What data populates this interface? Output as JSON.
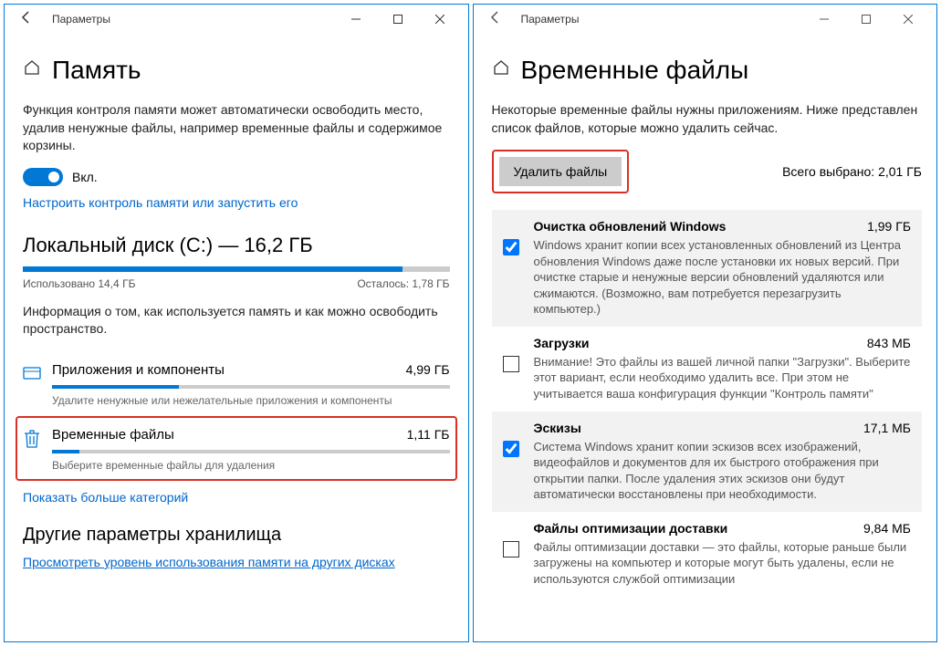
{
  "left": {
    "window_title": "Параметры",
    "page_title": "Память",
    "intro": "Функция контроля памяти может автоматически освободить место, удалив ненужные файлы, например временные файлы и содержимое корзины.",
    "toggle_label": "Вкл.",
    "configure_link": "Настроить контроль памяти или запустить его",
    "disk": {
      "title": "Локальный диск (C:) — 16,2 ГБ",
      "used": "Использовано 14,4 ГБ",
      "remaining": "Осталось: 1,78 ГБ",
      "fill_pct": 89
    },
    "disk_info": "Информация о том, как используется память и как можно освободить пространство.",
    "categories": [
      {
        "name": "Приложения и компоненты",
        "size": "4,99 ГБ",
        "desc": "Удалите ненужные или нежелательные приложения и компоненты",
        "fill_pct": 32
      },
      {
        "name": "Временные файлы",
        "size": "1,11 ГБ",
        "desc": "Выберите временные файлы для удаления",
        "fill_pct": 7
      }
    ],
    "show_more": "Показать больше категорий",
    "other_title": "Другие параметры хранилища",
    "other_link": "Просмотреть уровень использования памяти на других дисках"
  },
  "right": {
    "window_title": "Параметры",
    "page_title": "Временные файлы",
    "intro": "Некоторые временные файлы нужны приложениям. Ниже представлен список файлов, которые можно удалить сейчас.",
    "delete_btn": "Удалить файлы",
    "total": "Всего выбрано: 2,01 ГБ",
    "items": [
      {
        "name": "Очистка обновлений Windows",
        "size": "1,99 ГБ",
        "checked": true,
        "desc": "Windows хранит копии всех установленных обновлений из Центра обновления Windows даже после установки их новых версий. При очистке старые и ненужные версии обновлений удаляются или сжимаются. (Возможно, вам потребуется перезагрузить компьютер.)"
      },
      {
        "name": "Загрузки",
        "size": "843 МБ",
        "checked": false,
        "desc": "Внимание! Это файлы из вашей личной папки \"Загрузки\". Выберите этот вариант, если необходимо удалить все. При этом не учитывается ваша конфигурация функции \"Контроль памяти\""
      },
      {
        "name": "Эскизы",
        "size": "17,1 МБ",
        "checked": true,
        "desc": "Система Windows хранит копии эскизов всех изображений, видеофайлов и документов для их быстрого отображения при открытии папки. После удаления этих эскизов они будут автоматически восстановлены при необходимости."
      },
      {
        "name": "Файлы оптимизации доставки",
        "size": "9,84 МБ",
        "checked": false,
        "desc": "Файлы оптимизации доставки — это файлы, которые раньше были загружены на компьютер и которые могут быть удалены, если не используются службой оптимизации"
      }
    ]
  }
}
